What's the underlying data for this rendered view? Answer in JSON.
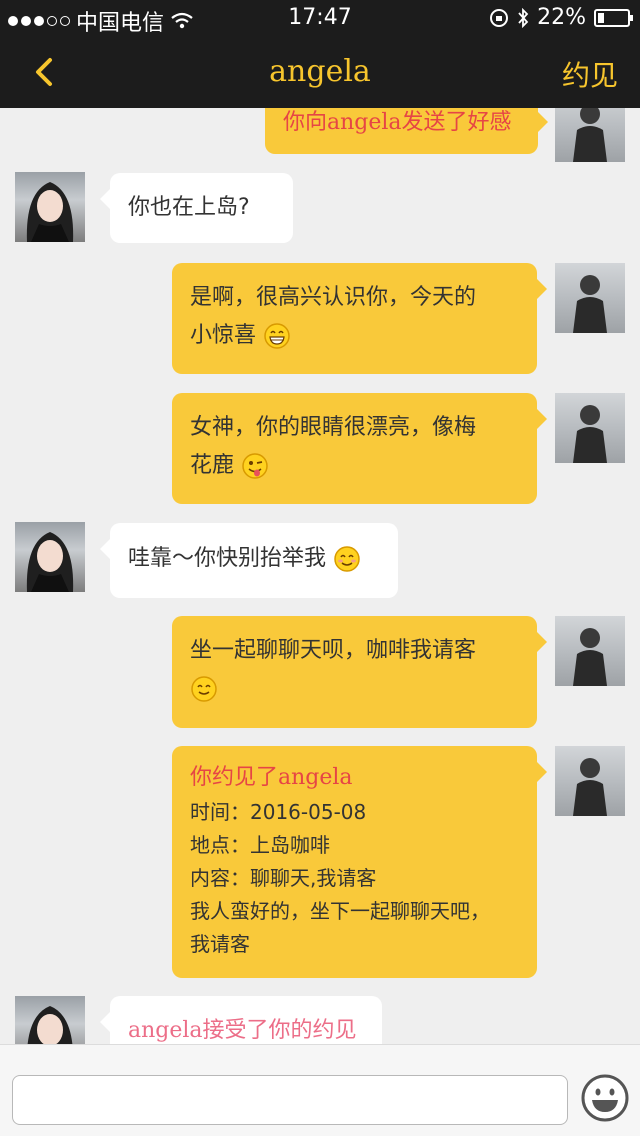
{
  "status_bar": {
    "carrier": "中国电信",
    "time": "17:47",
    "battery_text": "22%",
    "battery_level": 0.22,
    "icons": [
      "signal-dots-icon",
      "wifi-icon",
      "lock-rotation-icon",
      "bluetooth-icon",
      "battery-icon"
    ]
  },
  "nav": {
    "back_icon": "chevron-left-icon",
    "title": "angela",
    "action_label": "约见"
  },
  "messages": [
    {
      "side": "right",
      "avatar": "male-avatar",
      "text": "你向angela发送了好感",
      "style": "red-text"
    },
    {
      "side": "left",
      "avatar": "female-avatar",
      "text": "你也在上岛?"
    },
    {
      "side": "right",
      "avatar": "male-avatar",
      "line1": "是啊，很高兴认识你，今天的",
      "line2": "小惊喜",
      "emoji": "grinning-face-icon"
    },
    {
      "side": "right",
      "avatar": "male-avatar",
      "line1": "女神，你的眼睛很漂亮，像梅",
      "line2": "花鹿",
      "emoji": "winking-tongue-face-icon"
    },
    {
      "side": "left",
      "avatar": "female-avatar",
      "text": "哇靠～你快别抬举我",
      "emoji": "blushing-smile-face-icon"
    },
    {
      "side": "right",
      "avatar": "male-avatar",
      "line1": "坐一起聊聊天呗，咖啡我请客",
      "emoji": "smiling-face-icon"
    },
    {
      "side": "right",
      "avatar": "male-avatar",
      "title": "你约见了angela",
      "time_line": "时间：2016-05-08",
      "place_line": "地点：上岛咖啡",
      "content_line": "内容：聊聊天,我请客",
      "note_line1": "我人蛮好的，坐下一起聊聊天吧，",
      "note_line2": "我请客"
    },
    {
      "side": "left",
      "avatar": "female-avatar",
      "text": "angela接受了你的约见",
      "style": "pink-text"
    }
  ],
  "input": {
    "value": "",
    "emoji_button_icon": "emoji-picker-icon"
  },
  "colors": {
    "bar_background": "#1c1c1c",
    "accent_yellow": "#f7c52d",
    "bubble_yellow": "#f9c93a",
    "bubble_white": "#ffffff",
    "chat_background": "#efefef",
    "red_text": "#e64545",
    "pink_text": "#ec6e88"
  }
}
